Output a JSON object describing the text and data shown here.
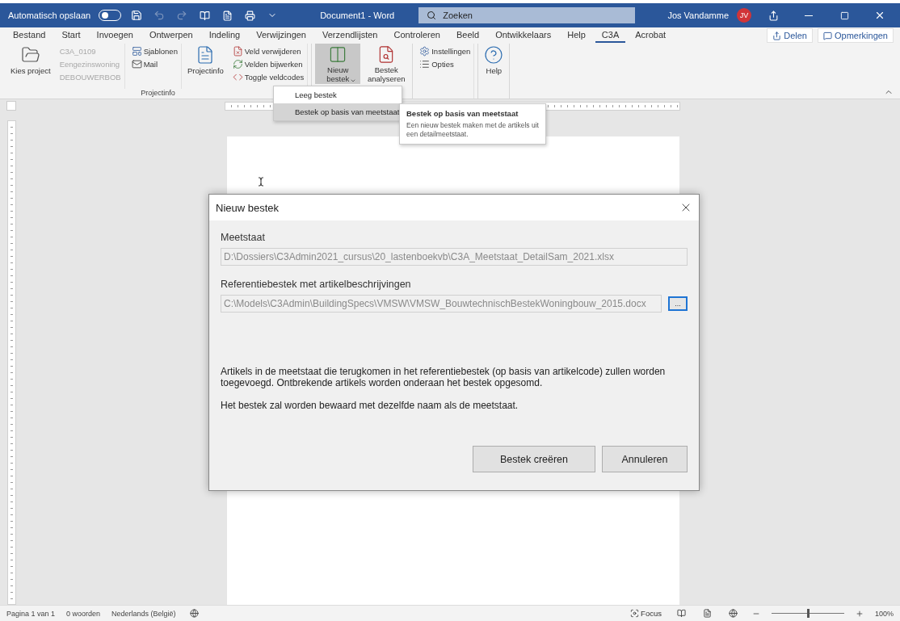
{
  "title_bar": {
    "autosave_label": "Automatisch opslaan",
    "autosave_on": false,
    "document_title": "Document1  -  Word",
    "search_placeholder": "Zoeken",
    "user_name": "Jos Vandamme",
    "avatar_initials": "JV"
  },
  "menu_tabs": [
    {
      "label": "Bestand",
      "selected": false
    },
    {
      "label": "Start",
      "selected": false
    },
    {
      "label": "Invoegen",
      "selected": false
    },
    {
      "label": "Ontwerpen",
      "selected": false
    },
    {
      "label": "Indeling",
      "selected": false
    },
    {
      "label": "Verwijzingen",
      "selected": false
    },
    {
      "label": "Verzendlijsten",
      "selected": false
    },
    {
      "label": "Controleren",
      "selected": false
    },
    {
      "label": "Beeld",
      "selected": false
    },
    {
      "label": "Ontwikkelaars",
      "selected": false
    },
    {
      "label": "Help",
      "selected": false
    },
    {
      "label": "C3A",
      "selected": true
    },
    {
      "label": "Acrobat",
      "selected": false
    }
  ],
  "share_buttons": [
    "Delen",
    "Opmerkingen"
  ],
  "ribbon": {
    "groups": [
      {
        "label": "Projectinfo",
        "controls": [
          {
            "kind": "large",
            "label": "Kies project",
            "disabled": false,
            "pressed": false,
            "caret": false
          },
          {
            "kind": "stack",
            "items": [
              {
                "label": "C3A_0109",
                "disabled": true
              },
              {
                "label": "Eengezinswoning",
                "disabled": true
              },
              {
                "label": "DEBOUWERBOB",
                "disabled": true
              }
            ]
          },
          {
            "kind": "stack",
            "items": [
              {
                "label": "Sjablonen",
                "disabled": false
              },
              {
                "label": "Mail",
                "disabled": false
              }
            ]
          },
          {
            "kind": "large",
            "label": "Projectinfo",
            "disabled": false,
            "pressed": false,
            "caret": false
          },
          {
            "kind": "stack",
            "items": [
              {
                "label": "Veld verwijderen",
                "disabled": false
              },
              {
                "label": "Velden bijwerken",
                "disabled": false
              },
              {
                "label": "Toggle veldcodes",
                "disabled": false
              }
            ]
          }
        ]
      },
      {
        "controls": [
          {
            "kind": "large",
            "label": "Nieuw bestek",
            "disabled": false,
            "pressed": true,
            "caret": true
          },
          {
            "kind": "large",
            "label": "Bestek analyseren",
            "disabled": false,
            "pressed": false,
            "caret": false
          }
        ]
      },
      {
        "controls": [
          {
            "kind": "stack",
            "items": [
              {
                "label": "Instellingen",
                "disabled": false
              },
              {
                "label": "Opties",
                "disabled": false
              }
            ]
          }
        ]
      },
      {
        "controls": [
          {
            "kind": "large",
            "label": "Help",
            "disabled": false,
            "pressed": false,
            "caret": false
          }
        ]
      }
    ]
  },
  "dropdown_menu": [
    {
      "label": "Leeg bestek",
      "selected": false
    },
    {
      "label": "Bestek op basis van meetstaat",
      "selected": true
    }
  ],
  "tooltip": {
    "title": "Bestek op basis van meetstaat",
    "text": "Een nieuw bestek maken met de artikels uit een detailmeetstaat."
  },
  "dialog": {
    "title": "Nieuw bestek",
    "fields": [
      {
        "label": "Meetstaat",
        "value": "D:\\Dossiers\\C3Admin2021_cursus\\20_lastenboekvb\\C3A_Meetstaat_DetailSam_2021.xlsx"
      },
      {
        "label": "Referentiebestek met artikelbeschrijvingen",
        "value": "C:\\Models\\C3Admin\\BuildingSpecs\\VMSW\\VMSW_BouwtechnischBestekWoningbouw_2015.docx",
        "browse_label": "..."
      }
    ],
    "notes": [
      "Artikels in de meetstaat die terugkomen in het referentiebestek (op basis van artikelcode) zullen worden toegevoegd. Ontbrekende artikels worden onderaan het bestek opgesomd.",
      "Het bestek zal worden bewaard met dezelfde naam als de meetstaat."
    ],
    "buttons": [
      "Bestek creëren",
      "Annuleren"
    ]
  },
  "status_bar": {
    "left": [
      "Pagina 1 van 1",
      "0 woorden",
      "Nederlands (België)"
    ],
    "focus_label": "Focus",
    "zoom": {
      "level": 0.5,
      "reading": "100%"
    }
  }
}
